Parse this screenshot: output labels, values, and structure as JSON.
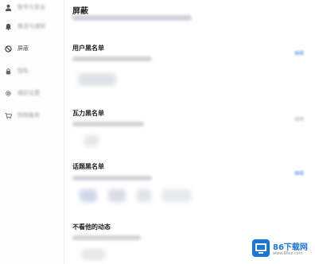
{
  "sidebar": {
    "items": [
      {
        "label": "账号与安全",
        "icon": "user-icon",
        "active": false
      },
      {
        "label": "推送与通知",
        "icon": "bell-icon",
        "active": false
      },
      {
        "label": "屏蔽",
        "icon": "block-icon",
        "active": true
      },
      {
        "label": "隐私",
        "icon": "lock-icon",
        "active": false
      },
      {
        "label": "偏好设置",
        "icon": "gear-icon",
        "active": false
      },
      {
        "label": "购物服务",
        "icon": "cart-icon",
        "active": false
      }
    ]
  },
  "page": {
    "title": "屏蔽"
  },
  "sections": [
    {
      "title": "用户黑名单",
      "action": "编辑"
    },
    {
      "title": "瓦力黑名单",
      "action": "编辑"
    },
    {
      "title": "话题黑名单",
      "action": "编辑"
    },
    {
      "title": "不看他的动态",
      "action": "编辑"
    }
  ],
  "watermark": {
    "brand": "86下载网",
    "url": "www.86xz.com"
  },
  "colors": {
    "accent": "#5b8fe0",
    "sidebar_bg": "#fdfdfd",
    "blurred_text": "#c7cbd1"
  }
}
